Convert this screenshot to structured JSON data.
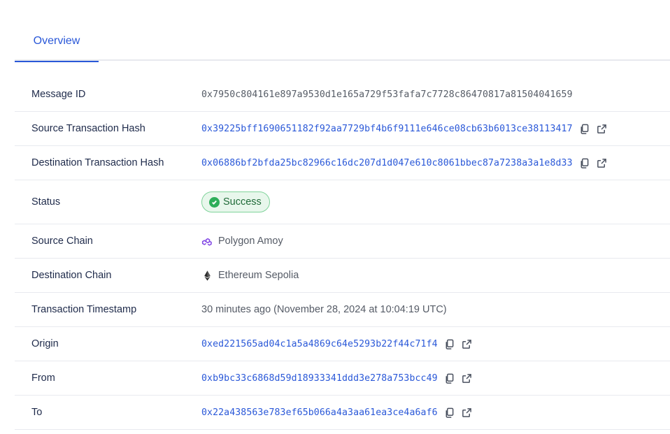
{
  "tabs": [
    {
      "label": "Overview",
      "active": true
    }
  ],
  "details": {
    "message_id": {
      "label": "Message ID",
      "value": "0x7950c804161e897a9530d1e165a729f53fafa7c7728c86470817a81504041659"
    },
    "source_tx_hash": {
      "label": "Source Transaction Hash",
      "value": "0x39225bff1690651182f92aa7729bf4b6f9111e646ce08cb63b6013ce38113417"
    },
    "destination_tx_hash": {
      "label": "Destination Transaction Hash",
      "value": "0x06886bf2bfda25bc82966c16dc207d1d047e610c8061bbec87a7238a3a1e8d33"
    },
    "status": {
      "label": "Status",
      "value": "Success",
      "color": "#2eae5a"
    },
    "source_chain": {
      "label": "Source Chain",
      "value": "Polygon Amoy",
      "icon": "polygon-icon",
      "color": "#8247e5"
    },
    "destination_chain": {
      "label": "Destination Chain",
      "value": "Ethereum Sepolia",
      "icon": "ethereum-icon"
    },
    "timestamp": {
      "label": "Transaction Timestamp",
      "value": "30 minutes ago (November 28, 2024 at 10:04:19 UTC)"
    },
    "origin": {
      "label": "Origin",
      "value": "0xed221565ad04c1a5a4869c64e5293b22f44c71f4"
    },
    "from": {
      "label": "From",
      "value": "0xb9bc33c6868d59d18933341ddd3e278a753bcc49"
    },
    "to": {
      "label": "To",
      "value": "0x22a438563e783ef65b066a4a3aa61ea3ce4a6af6"
    }
  },
  "accent_color": "#2a58d8"
}
